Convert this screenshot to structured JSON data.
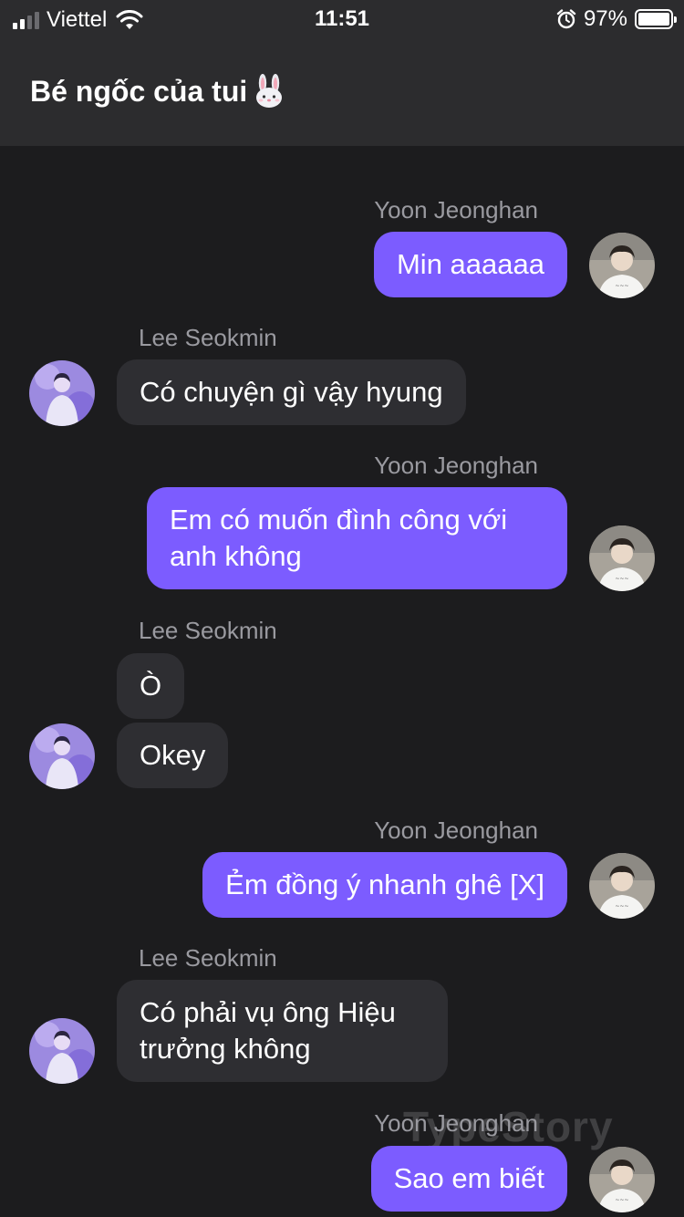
{
  "status_bar": {
    "carrier": "Viettel",
    "time": "11:51",
    "battery_percent": "97%",
    "signal_bars": 4,
    "signal_active": 2,
    "icons": [
      "signal-icon",
      "wifi-icon",
      "alarm-icon",
      "battery-icon"
    ]
  },
  "header": {
    "title": "Bé ngốc của tui",
    "title_icon": "bunny-face-icon"
  },
  "colors": {
    "outgoing_bubble": "#7c5cff",
    "incoming_bubble": "#2e2e32",
    "background": "#1c1c1e",
    "header": "#2c2c2e"
  },
  "messages": [
    {
      "sender": "Yoon Jeonghan",
      "text": "Min aaaaaa"
    },
    {
      "sender": "Lee Seokmin",
      "text": "Có chuyện gì vậy hyung"
    },
    {
      "sender": "Yoon Jeonghan",
      "text": "Em có muốn đình công với anh không"
    },
    {
      "sender": "Lee Seokmin",
      "text": "Ò"
    },
    {
      "sender": "Lee Seokmin",
      "text": "Okey"
    },
    {
      "sender": "Yoon Jeonghan",
      "text": "Ẻm đồng ý nhanh ghê [X]"
    },
    {
      "sender": "Lee Seokmin",
      "text": "Có phải vụ ông Hiệu trưởng không"
    },
    {
      "sender": "Yoon Jeonghan",
      "text": "Sao em biết"
    }
  ],
  "senders": {
    "jeonghan": "Yoon Jeonghan",
    "seokmin": "Lee Seokmin"
  },
  "watermark": "TypeStory"
}
